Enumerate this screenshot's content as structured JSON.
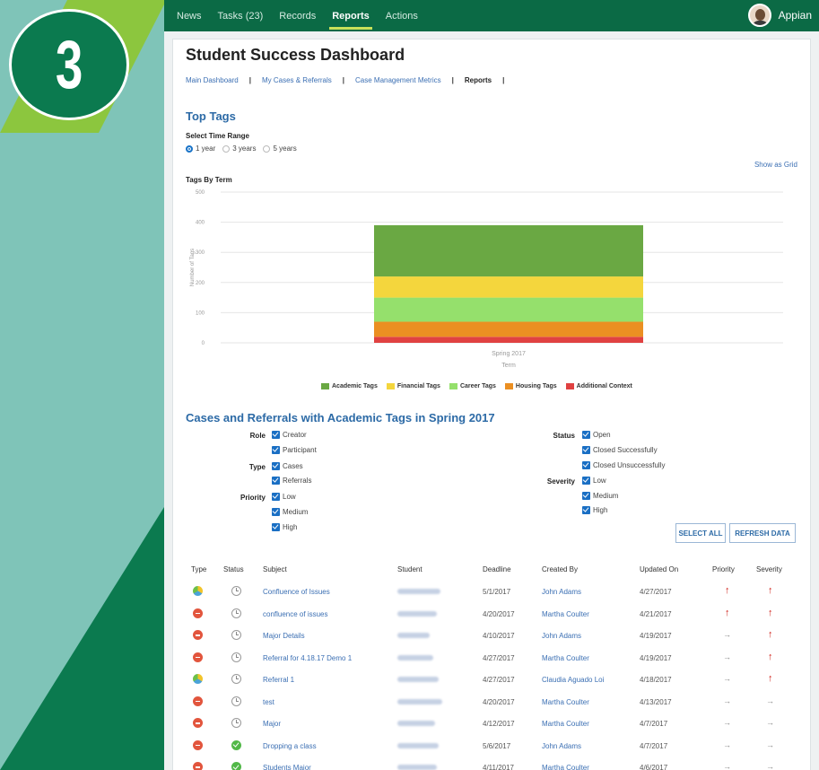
{
  "badge": {
    "number": "3"
  },
  "nav": {
    "items": [
      {
        "label": "News",
        "active": false
      },
      {
        "label": "Tasks (23)",
        "active": false
      },
      {
        "label": "Records",
        "active": false
      },
      {
        "label": "Reports",
        "active": true
      },
      {
        "label": "Actions",
        "active": false
      }
    ],
    "brand": "Appian"
  },
  "page": {
    "title": "Student Success Dashboard",
    "breadcrumbs": [
      "Main Dashboard",
      "My Cases & Referrals",
      "Case Management Metrics",
      "Reports"
    ]
  },
  "top_tags": {
    "heading": "Top Tags",
    "time_range_label": "Select Time Range",
    "options": [
      "1 year",
      "3 years",
      "5 years"
    ],
    "selected": "1 year",
    "show_grid": "Show as Grid"
  },
  "chart_data": {
    "type": "bar",
    "stacked": true,
    "title": "Tags By Term",
    "xlabel": "Term",
    "ylabel": "Number of Tags",
    "categories": [
      "Spring 2017"
    ],
    "ylim": [
      0,
      500
    ],
    "yticks": [
      "0",
      "100",
      "200",
      "300",
      "400",
      "500"
    ],
    "series": [
      {
        "name": "Academic Tags",
        "color": "#6aa843",
        "values": [
          170
        ]
      },
      {
        "name": "Financial Tags",
        "color": "#f4d63d",
        "values": [
          70
        ]
      },
      {
        "name": "Career Tags",
        "color": "#95e06c",
        "values": [
          80
        ]
      },
      {
        "name": "Housing Tags",
        "color": "#eb8f22",
        "values": [
          50
        ]
      },
      {
        "name": "Additional Context",
        "color": "#e04141",
        "values": [
          20
        ]
      }
    ],
    "legend_position": "bottom",
    "grid": true
  },
  "cases": {
    "heading": "Cases and Referrals with Academic Tags in Spring 2017",
    "filters_left": [
      {
        "label": "Role",
        "options": [
          "Creator",
          "Participant"
        ]
      },
      {
        "label": "Type",
        "options": [
          "Cases",
          "Referrals"
        ]
      },
      {
        "label": "Priority",
        "options": [
          "Low",
          "Medium",
          "High"
        ]
      }
    ],
    "filters_right": [
      {
        "label": "Status",
        "options": [
          "Open",
          "Closed Successfully",
          "Closed Unsuccessfully"
        ]
      },
      {
        "label": "Severity",
        "options": [
          "Low",
          "Medium",
          "High"
        ]
      }
    ],
    "select_all": "SELECT ALL",
    "refresh": "REFRESH DATA"
  },
  "table": {
    "headers": [
      "Type",
      "Status",
      "Subject",
      "Student",
      "Deadline",
      "Created By",
      "Updated On",
      "Priority",
      "Severity"
    ],
    "rows": [
      {
        "type": "multi",
        "status": "clock",
        "subject": "Confluence of Issues",
        "deadline": "5/1/2017",
        "created_by": "John Adams",
        "updated_on": "4/27/2017",
        "priority": "high",
        "severity": "high"
      },
      {
        "type": "red",
        "status": "clock",
        "subject": "confluence of issues",
        "deadline": "4/20/2017",
        "created_by": "Martha Coulter",
        "updated_on": "4/21/2017",
        "priority": "high",
        "severity": "high"
      },
      {
        "type": "red",
        "status": "clock",
        "subject": "Major Details",
        "deadline": "4/10/2017",
        "created_by": "John Adams",
        "updated_on": "4/19/2017",
        "priority": "normal",
        "severity": "high"
      },
      {
        "type": "red",
        "status": "clock",
        "subject": "Referral for 4.18.17 Demo 1",
        "deadline": "4/27/2017",
        "created_by": "Martha Coulter",
        "updated_on": "4/19/2017",
        "priority": "normal",
        "severity": "high"
      },
      {
        "type": "multi",
        "status": "clock",
        "subject": "Referral 1",
        "deadline": "4/27/2017",
        "created_by": "Claudia Aguado Loi",
        "updated_on": "4/18/2017",
        "priority": "normal",
        "severity": "high"
      },
      {
        "type": "red",
        "status": "clock",
        "subject": "test",
        "deadline": "4/20/2017",
        "created_by": "Martha Coulter",
        "updated_on": "4/13/2017",
        "priority": "normal",
        "severity": "normal"
      },
      {
        "type": "red",
        "status": "clock",
        "subject": "Major",
        "deadline": "4/12/2017",
        "created_by": "Martha Coulter",
        "updated_on": "4/7/2017",
        "priority": "normal",
        "severity": "normal"
      },
      {
        "type": "red",
        "status": "done",
        "subject": "Dropping a class",
        "deadline": "5/6/2017",
        "created_by": "John Adams",
        "updated_on": "4/7/2017",
        "priority": "normal",
        "severity": "normal"
      },
      {
        "type": "red",
        "status": "done",
        "subject": "Students Major",
        "deadline": "4/11/2017",
        "created_by": "Martha Coulter",
        "updated_on": "4/6/2017",
        "priority": "normal",
        "severity": "normal"
      }
    ]
  }
}
